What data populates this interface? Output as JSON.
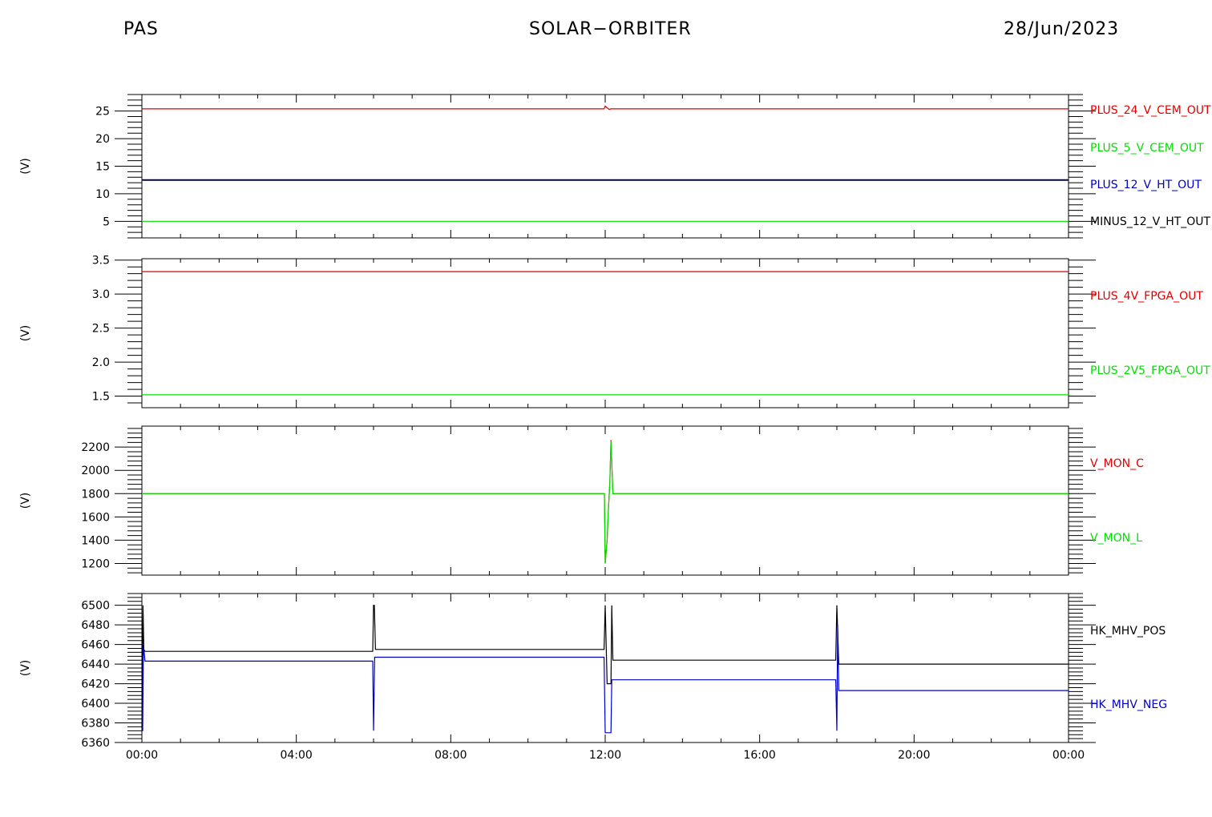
{
  "header": {
    "left": "PAS",
    "center": "SOLAR−ORBITER",
    "right": "28/Jun/2023"
  },
  "colors": {
    "red": "#e00000",
    "green": "#00e000",
    "blue": "#0000c8",
    "black": "#000000"
  },
  "chart_data": [
    {
      "type": "line",
      "ylabel": "(V)",
      "ylim": [
        2,
        28
      ],
      "yticks": [
        5,
        10,
        15,
        20,
        25
      ],
      "series": [
        {
          "name": "PLUS_24_V_CEM_OUT",
          "color": "#e00000",
          "x": [
            0,
            11.97,
            12.0,
            12.05,
            12.1,
            12.15,
            24
          ],
          "y": [
            25.4,
            25.4,
            25.9,
            25.6,
            25.3,
            25.4,
            25.4
          ]
        },
        {
          "name": "PLUS_5_V_CEM_OUT",
          "color": "#00e000",
          "x": [
            0,
            24
          ],
          "y": [
            5.0,
            5.0
          ]
        },
        {
          "name": "PLUS_12_V_HT_OUT",
          "color": "#0000c8",
          "x": [
            0,
            24
          ],
          "y": [
            12.5,
            12.5
          ],
          "width": 2
        },
        {
          "name": "MINUS_12_V_HT_OUT",
          "color": "#000000",
          "x": [
            0,
            24
          ],
          "y": [
            12.5,
            12.5
          ],
          "width": 1
        }
      ]
    },
    {
      "type": "line",
      "ylabel": "(V)",
      "ylim": [
        1.33,
        3.52
      ],
      "yticks": [
        1.5,
        2.0,
        2.5,
        3.0,
        3.5
      ],
      "yfmt": 1,
      "series": [
        {
          "name": "PLUS_4V_FPGA_OUT",
          "color": "#e00000",
          "x": [
            0,
            24
          ],
          "y": [
            3.33,
            3.33
          ]
        },
        {
          "name": "PLUS_2V5_FPGA_OUT",
          "color": "#00e000",
          "x": [
            0,
            24
          ],
          "y": [
            1.52,
            1.52
          ]
        }
      ]
    },
    {
      "type": "line",
      "ylabel": "(V)",
      "ylim": [
        1100,
        2380
      ],
      "yticks": [
        1200,
        1400,
        1600,
        1800,
        2000,
        2200
      ],
      "series": [
        {
          "name": "V_MON_C",
          "color": "#e00000",
          "x": [
            0,
            11.98,
            12.0,
            12.05,
            12.08,
            12.12,
            12.15,
            12.2,
            24
          ],
          "y": [
            1800,
            1800,
            1200,
            1400,
            1650,
            1900,
            2260,
            1800,
            1800
          ]
        },
        {
          "name": "V_MON_L",
          "color": "#00e000",
          "x": [
            0,
            11.98,
            12.0,
            12.05,
            12.08,
            12.12,
            12.15,
            12.2,
            24
          ],
          "y": [
            1800,
            1800,
            1200,
            1400,
            1650,
            1900,
            2250,
            1800,
            1800
          ]
        }
      ]
    },
    {
      "type": "line",
      "ylabel": "(V)",
      "ylim": [
        6360,
        6512
      ],
      "yticks": [
        6360,
        6380,
        6400,
        6420,
        6440,
        6460,
        6480,
        6500
      ],
      "x_ticks_labels": [
        "00:00",
        "04:00",
        "08:00",
        "12:00",
        "16:00",
        "20:00",
        "00:00"
      ],
      "xlim": [
        0,
        24
      ],
      "series": [
        {
          "name": "HK_MHV_POS",
          "color": "#000000",
          "x": [
            0,
            0.03,
            0.05,
            0.08,
            0.1,
            5.98,
            6.0,
            6.02,
            6.05,
            6.1,
            11.97,
            12.0,
            12.05,
            12.15,
            12.17,
            12.2,
            12.25,
            17.97,
            18.0,
            18.05,
            18.1,
            24
          ],
          "y": [
            6375,
            6500,
            6455,
            6453,
            6453,
            6453,
            6500,
            6500,
            6455,
            6455,
            6455,
            6500,
            6420,
            6420,
            6500,
            6444,
            6444,
            6444,
            6500,
            6440,
            6440,
            6440
          ]
        },
        {
          "name": "HK_MHV_NEG",
          "color": "#0000c8",
          "x": [
            0,
            0.02,
            0.04,
            0.08,
            0.1,
            5.98,
            6.0,
            6.03,
            6.08,
            11.97,
            12.0,
            12.05,
            12.15,
            12.17,
            12.2,
            12.25,
            17.97,
            18.0,
            18.02,
            18.05,
            18.1,
            24
          ],
          "y": [
            6372,
            6372,
            6460,
            6443,
            6443,
            6443,
            6372,
            6447,
            6447,
            6447,
            6370,
            6370,
            6370,
            6424,
            6424,
            6424,
            6424,
            6372,
            6480,
            6413,
            6413,
            6413
          ]
        }
      ]
    }
  ]
}
